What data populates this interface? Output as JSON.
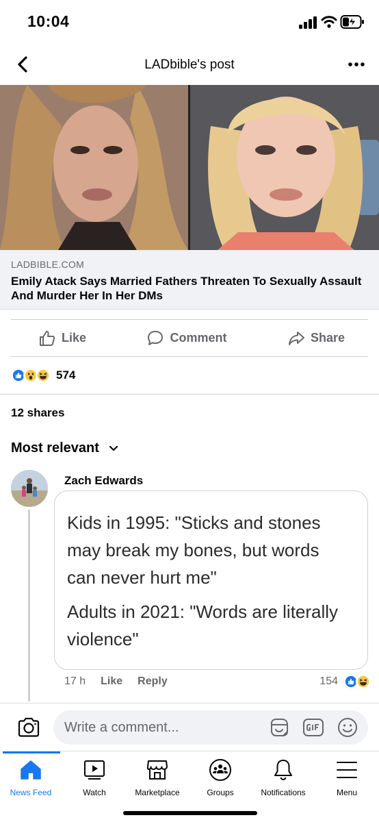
{
  "status_bar": {
    "time": "10:04"
  },
  "header": {
    "title": "LADbible's post"
  },
  "link_preview": {
    "domain": "LADBIBLE.COM",
    "title": "Emily Atack Says Married Fathers Threaten To Sexually Assault And Murder Her In Her DMs"
  },
  "actions": {
    "like": "Like",
    "comment": "Comment",
    "share": "Share"
  },
  "reactions": {
    "count": "574",
    "icons": [
      "like-icon",
      "wow-icon",
      "haha-icon"
    ]
  },
  "shares": "12 shares",
  "sort": {
    "label": "Most relevant"
  },
  "comment": {
    "author": "Zach Edwards",
    "lines_1": [
      "Kids in 1995: \"Sticks and stones",
      "may break my bones, but words",
      "can never hurt me\""
    ],
    "lines_2": [
      "Adults in 2021: \"Words are literally",
      "violence\""
    ],
    "time": "17 h",
    "like": "Like",
    "reply": "Reply",
    "reaction_count": "154"
  },
  "composer": {
    "placeholder": "Write a comment..."
  },
  "tabs": [
    {
      "label": "News Feed",
      "icon": "home-icon",
      "active": true
    },
    {
      "label": "Watch",
      "icon": "watch-icon"
    },
    {
      "label": "Marketplace",
      "icon": "marketplace-icon"
    },
    {
      "label": "Groups",
      "icon": "groups-icon"
    },
    {
      "label": "Notifications",
      "icon": "bell-icon"
    },
    {
      "label": "Menu",
      "icon": "menu-icon"
    }
  ],
  "colors": {
    "brand_blue": "#1877f2",
    "secondary_text": "#65676b",
    "link_bg": "#f0f2f5"
  }
}
